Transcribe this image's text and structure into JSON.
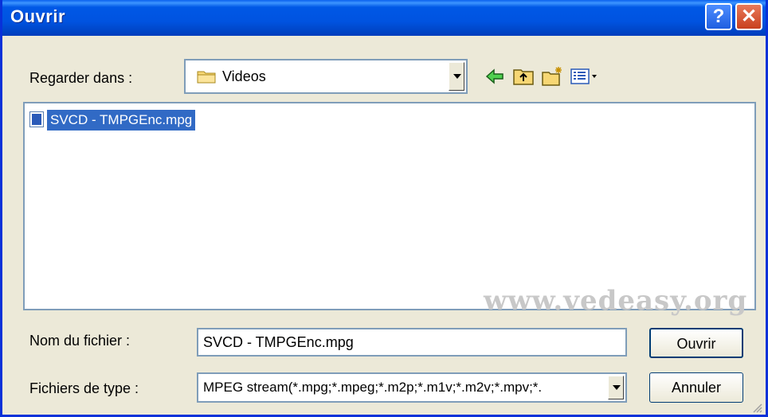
{
  "dialog": {
    "title": "Ouvrir",
    "help_label": "?",
    "close_label": "✕"
  },
  "look_in": {
    "label": "Regarder dans :",
    "value": "Videos"
  },
  "files": [
    {
      "name": "SVCD - TMPGEnc.mpg",
      "selected": true
    }
  ],
  "watermark": "www.vedeasy.org",
  "filename": {
    "label": "Nom du fichier :",
    "value": "SVCD - TMPGEnc.mpg"
  },
  "filetype": {
    "label": "Fichiers de type :",
    "value": "MPEG stream(*.mpg;*.mpeg;*.m2p;*.m1v;*.m2v;*.mpv;*."
  },
  "buttons": {
    "open": "Ouvrir",
    "cancel": "Annuler"
  },
  "colors": {
    "titlebar": "#0054e3",
    "selection": "#316ac5",
    "dialog_bg": "#ece9d8"
  }
}
